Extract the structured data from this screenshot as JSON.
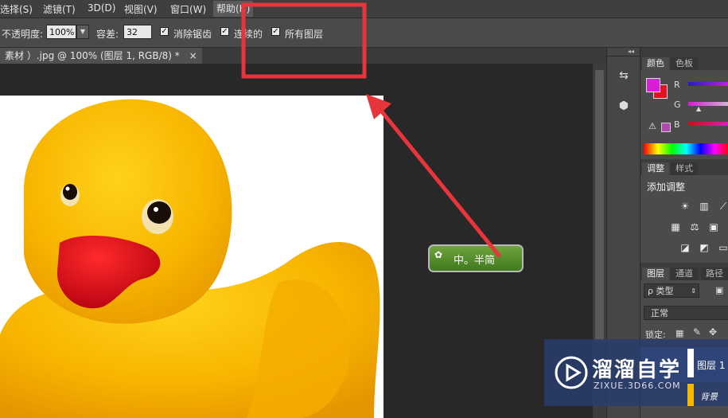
{
  "menubar": {
    "items": [
      {
        "label": "选择(S)"
      },
      {
        "label": "滤镜(T)"
      },
      {
        "label": "3D(D)"
      },
      {
        "label": "视图(V)"
      },
      {
        "label": "窗口(W)"
      },
      {
        "label": "帮助(H)"
      }
    ]
  },
  "options": {
    "opacity_label": "不透明度:",
    "opacity_value": "100%",
    "tolerance_label": "容差:",
    "tolerance_value": "32",
    "antialias_label": "消除锯齿",
    "contiguous_label": "连续的",
    "all_layers_label": "所有图层"
  },
  "document": {
    "tab_title": "素材 ）.jpg @ 100% (图层 1, RGB/8) *",
    "close": "×"
  },
  "panels": {
    "collapse": "◂◂",
    "color_tab": "颜色",
    "swatches_tab": "色板",
    "r_label": "R",
    "g_label": "G",
    "b_label": "B",
    "adjust_tab": "调整",
    "styles_tab": "样式",
    "add_adjust": "添加调整",
    "layers_tab": "图层",
    "channels_tab": "通道",
    "paths_tab": "路径",
    "kind_label": "ρ 类型",
    "blend_mode": "正常",
    "lock_label": "锁定:",
    "layer1_name": "图层 1",
    "background_name": "背景"
  },
  "badge": {
    "text": "中。半简"
  },
  "watermark": {
    "name": "溜溜自学",
    "url": "ZIXUE.3D66.COM"
  },
  "colors": {
    "foreground": "#d81fd8",
    "background": "#e0141e",
    "annotation": "#e8353c"
  }
}
